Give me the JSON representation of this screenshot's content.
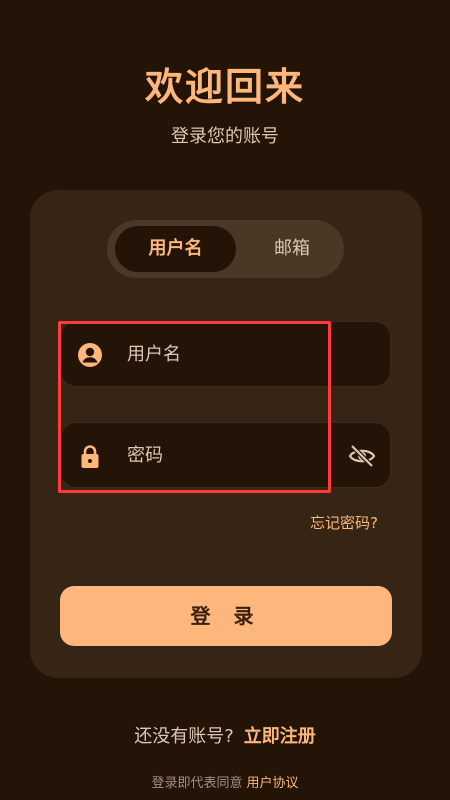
{
  "header": {
    "title": "欢迎回来",
    "subtitle": "登录您的账号"
  },
  "tabs": [
    {
      "label": "用户名",
      "active": true
    },
    {
      "label": "邮箱",
      "active": false
    }
  ],
  "form": {
    "username_placeholder": "用户名",
    "password_placeholder": "密码",
    "forgot_label": "忘记密码?",
    "login_label": "登 录",
    "icons": {
      "username": "user-circle-icon",
      "password": "lock-icon",
      "toggle": "eye-off-icon"
    }
  },
  "footer": {
    "register_question": "还没有账号?",
    "register_link": "立即注册",
    "agreement_text": "登录即代表同意",
    "agreement_link": "用户协议"
  },
  "colors": {
    "background": "#241307",
    "card": "#362414",
    "accent": "#FDB67C",
    "highlight": "#ff3b3b"
  }
}
